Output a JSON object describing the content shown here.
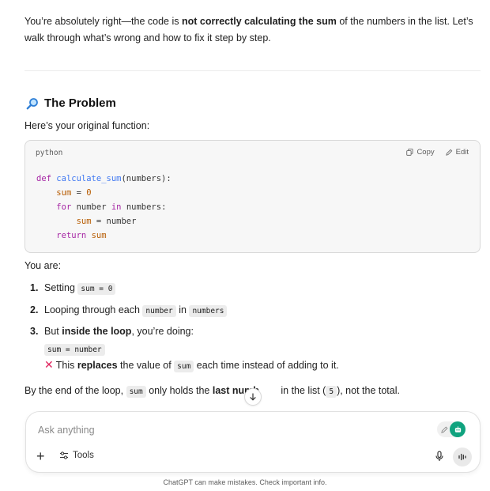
{
  "intro": {
    "part1": "You’re absolutely right—the code is ",
    "bold": "not correctly calculating the sum",
    "part2": " of the numbers in the list. Let’s walk through what’s wrong and how to fix it step by step."
  },
  "problem": {
    "icon": "magnifier-icon",
    "title": "The Problem",
    "subtitle": "Here’s your original function:"
  },
  "codeblock": {
    "language": "python",
    "copy_label": "Copy",
    "edit_label": "Edit",
    "lines": [
      {
        "kw": "def",
        "fn": "calculate_sum",
        "rest": "(numbers):"
      },
      {
        "var": "sum",
        "rest": " = ",
        "num": "0"
      },
      {
        "kw": "for",
        "rest1": " number ",
        "kw2": "in",
        "rest2": " numbers:"
      },
      {
        "var": "sum",
        "rest": " = number"
      },
      {
        "kw": "return",
        "var": "sum"
      }
    ]
  },
  "you_are": "You are:",
  "steps": [
    {
      "num": "1.",
      "text": "Setting ",
      "code": "sum = 0"
    },
    {
      "num": "2.",
      "text": "Looping through each ",
      "code": "number",
      "mid": " in ",
      "code2": "numbers"
    },
    {
      "num": "3.",
      "text": "But ",
      "bold": "inside the loop",
      "rest": ", you’re doing:",
      "code": "sum = number",
      "note_pre": "This ",
      "note_bold": "replaces",
      "note_mid": " the value of ",
      "note_code": "sum",
      "note_end": " each time instead of adding to it."
    }
  ],
  "endline": {
    "part1": "By the end of the loop, ",
    "code": "sum",
    "part2": " only holds the ",
    "bold": "last numb",
    "part3": " in the list (",
    "code2": "5",
    "part4": "), not the total."
  },
  "composer": {
    "placeholder": "Ask anything",
    "tools_label": "Tools"
  },
  "footer": "ChatGPT can make mistakes. Check important info.",
  "colors": {
    "accent_green": "#10a37f",
    "error_cross": "#e0245e"
  }
}
